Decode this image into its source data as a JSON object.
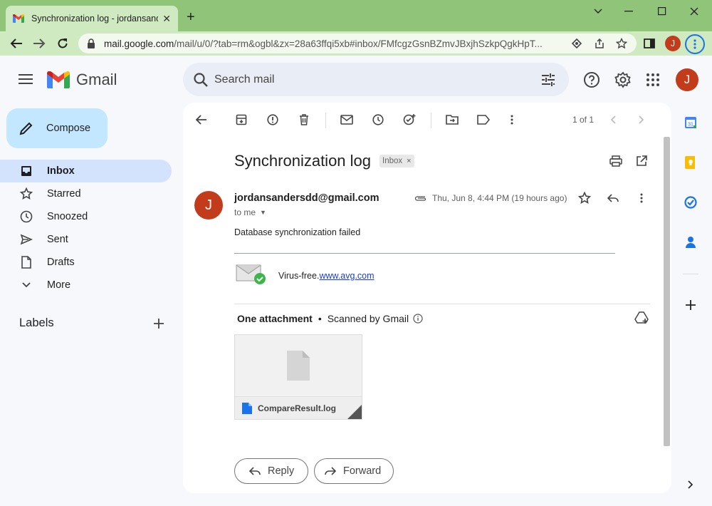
{
  "browser": {
    "tab_title": "Synchronization log - jordansanders",
    "url_host": "mail.google.com",
    "url_path": "/mail/u/0/?tab=rm&ogbl&zx=28a63ffqi5xb#inbox/FMfcgzGsnBZmvJBxjhSzkpQgkHpT...",
    "profile_initial": "J",
    "accent_color": "#8fc479"
  },
  "gmail": {
    "app_name": "Gmail",
    "search_placeholder": "Search mail",
    "profile_initial": "J"
  },
  "sidebar": {
    "compose_label": "Compose",
    "items": [
      {
        "label": "Inbox",
        "icon": "inbox-icon",
        "active": true
      },
      {
        "label": "Starred",
        "icon": "star-icon"
      },
      {
        "label": "Snoozed",
        "icon": "clock-icon"
      },
      {
        "label": "Sent",
        "icon": "send-icon"
      },
      {
        "label": "Drafts",
        "icon": "draft-icon"
      },
      {
        "label": "More",
        "icon": "chevron-down-icon"
      }
    ],
    "labels_title": "Labels"
  },
  "toolbar": {
    "count": "1 of 1"
  },
  "message": {
    "subject": "Synchronization log",
    "label_chip": "Inbox",
    "sender_initial": "J",
    "sender": "jordansandersdd@gmail.com",
    "recipient": "to me",
    "date": "Thu, Jun 8, 4:44 PM (19 hours ago)",
    "body": "Database synchronization failed",
    "avg_text": "Virus-free.",
    "avg_link": "www.avg.com"
  },
  "attachments": {
    "count_label": "One attachment",
    "scan_label": "Scanned by Gmail",
    "files": [
      {
        "name": "CompareResult.log"
      }
    ]
  },
  "actions": {
    "reply_label": "Reply",
    "forward_label": "Forward"
  }
}
